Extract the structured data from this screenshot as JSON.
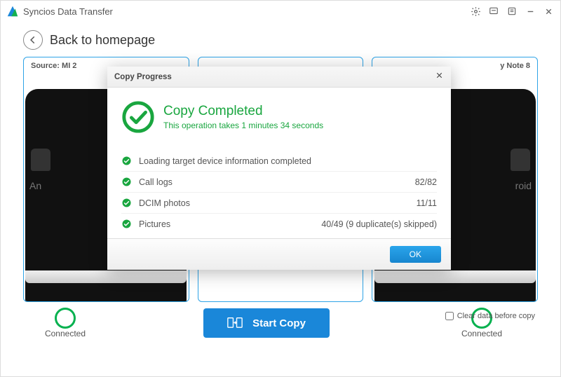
{
  "app": {
    "title": "Syncios Data Transfer"
  },
  "nav": {
    "back_label": "Back to homepage"
  },
  "source": {
    "prefix": "Source:",
    "device": "MI 2",
    "half_text": "An"
  },
  "target": {
    "device": "y Note 8",
    "half_text": "roid"
  },
  "footer": {
    "connected_left": "Connected",
    "connected_right": "Connected",
    "start_copy": "Start Copy",
    "clear_data": "Clear data before copy"
  },
  "dialog": {
    "title": "Copy Progress",
    "heading": "Copy Completed",
    "subtitle": "This operation takes 1 minutes 34 seconds",
    "items": [
      {
        "label": "Loading target device information completed",
        "count": ""
      },
      {
        "label": "Call logs",
        "count": "82/82"
      },
      {
        "label": "DCIM photos",
        "count": "11/11"
      },
      {
        "label": "Pictures",
        "count": "40/49 (9 duplicate(s) skipped)"
      }
    ],
    "ok": "OK"
  }
}
